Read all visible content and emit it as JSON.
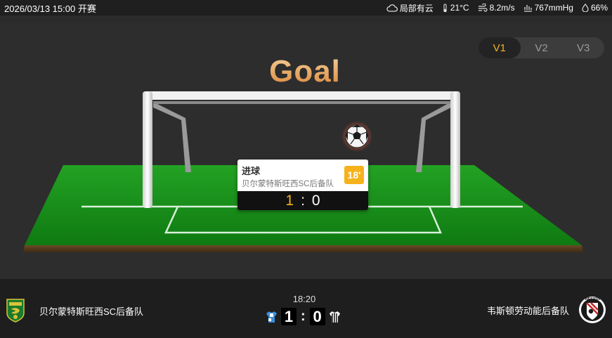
{
  "header": {
    "match_time": "2026/03/13 15:00 开赛",
    "weather": {
      "condition": "局部有云",
      "temperature": "21°C",
      "wind": "8.2m/s",
      "pressure": "767mmHg",
      "humidity": "66%"
    }
  },
  "view_tabs": [
    "V1",
    "V2",
    "V3"
  ],
  "active_tab": "V1",
  "stage": {
    "title": "Goal"
  },
  "event": {
    "title": "进球",
    "team": "贝尔蒙特斯旺西SC后备队",
    "minute": "18'",
    "home_score": "1",
    "separator": ":",
    "away_score": "0"
  },
  "footer": {
    "clock": "18:20",
    "home_team": "贝尔蒙特斯旺西SC后备队",
    "away_team": "韦斯顿劳动能后备队",
    "home_score": "1",
    "separator": ":",
    "away_score": "0",
    "away_logo_text": "WESTON"
  },
  "colors": {
    "accent": "#f6b21a",
    "pitch": "#1d8f1d",
    "home_kit": "#3a8fd9",
    "away_kit": "#222222"
  }
}
